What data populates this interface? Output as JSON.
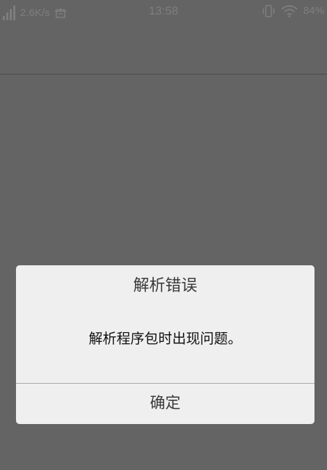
{
  "status_bar": {
    "net_speed": "2.6K/s",
    "time": "13:58",
    "battery": "84%",
    "icons": [
      "signal-icon",
      "sync-icon",
      "vibrate-icon",
      "wifi-icon"
    ]
  },
  "dialog": {
    "title": "解析错误",
    "message": "解析程序包时出现问题。",
    "ok_label": "确定"
  },
  "colors": {
    "overlay": "#646464",
    "dialog_bg": "#efefef",
    "divider": "#a8a8a8",
    "status_text": "#7e7e7e"
  }
}
